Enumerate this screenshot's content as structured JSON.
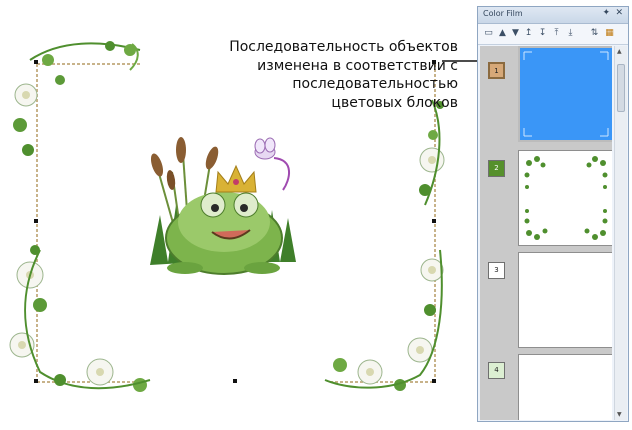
{
  "callout": {
    "lines": [
      "Последовательность объектов",
      "изменена в соответствии с",
      "последовательностью",
      "цветовых блоков"
    ]
  },
  "panel": {
    "title": "Color Film",
    "pin_icon": "pin-icon",
    "close_icon": "close-icon",
    "toolbar_icons": [
      "film-view-icon",
      "move-up-icon",
      "move-down-icon",
      "move-up-one-icon",
      "move-down-one-icon",
      "move-to-start-icon",
      "move-to-end-icon",
      "sort-icon",
      "color-blocks-icon"
    ]
  },
  "blocks": [
    {
      "number": "1",
      "color": "#d6a878",
      "selected": true
    },
    {
      "number": "2",
      "color": "#56902c",
      "selected": false
    },
    {
      "number": "3",
      "color": "#ffffff",
      "selected": false
    },
    {
      "number": "4",
      "color": "#dcefd2",
      "selected": false
    }
  ],
  "colors": {
    "selection": "#3a96f7",
    "leaf": "#4f8f2e",
    "frog": "#7db44c",
    "crown": "#d9b235",
    "cattail": "#8a5d32"
  }
}
